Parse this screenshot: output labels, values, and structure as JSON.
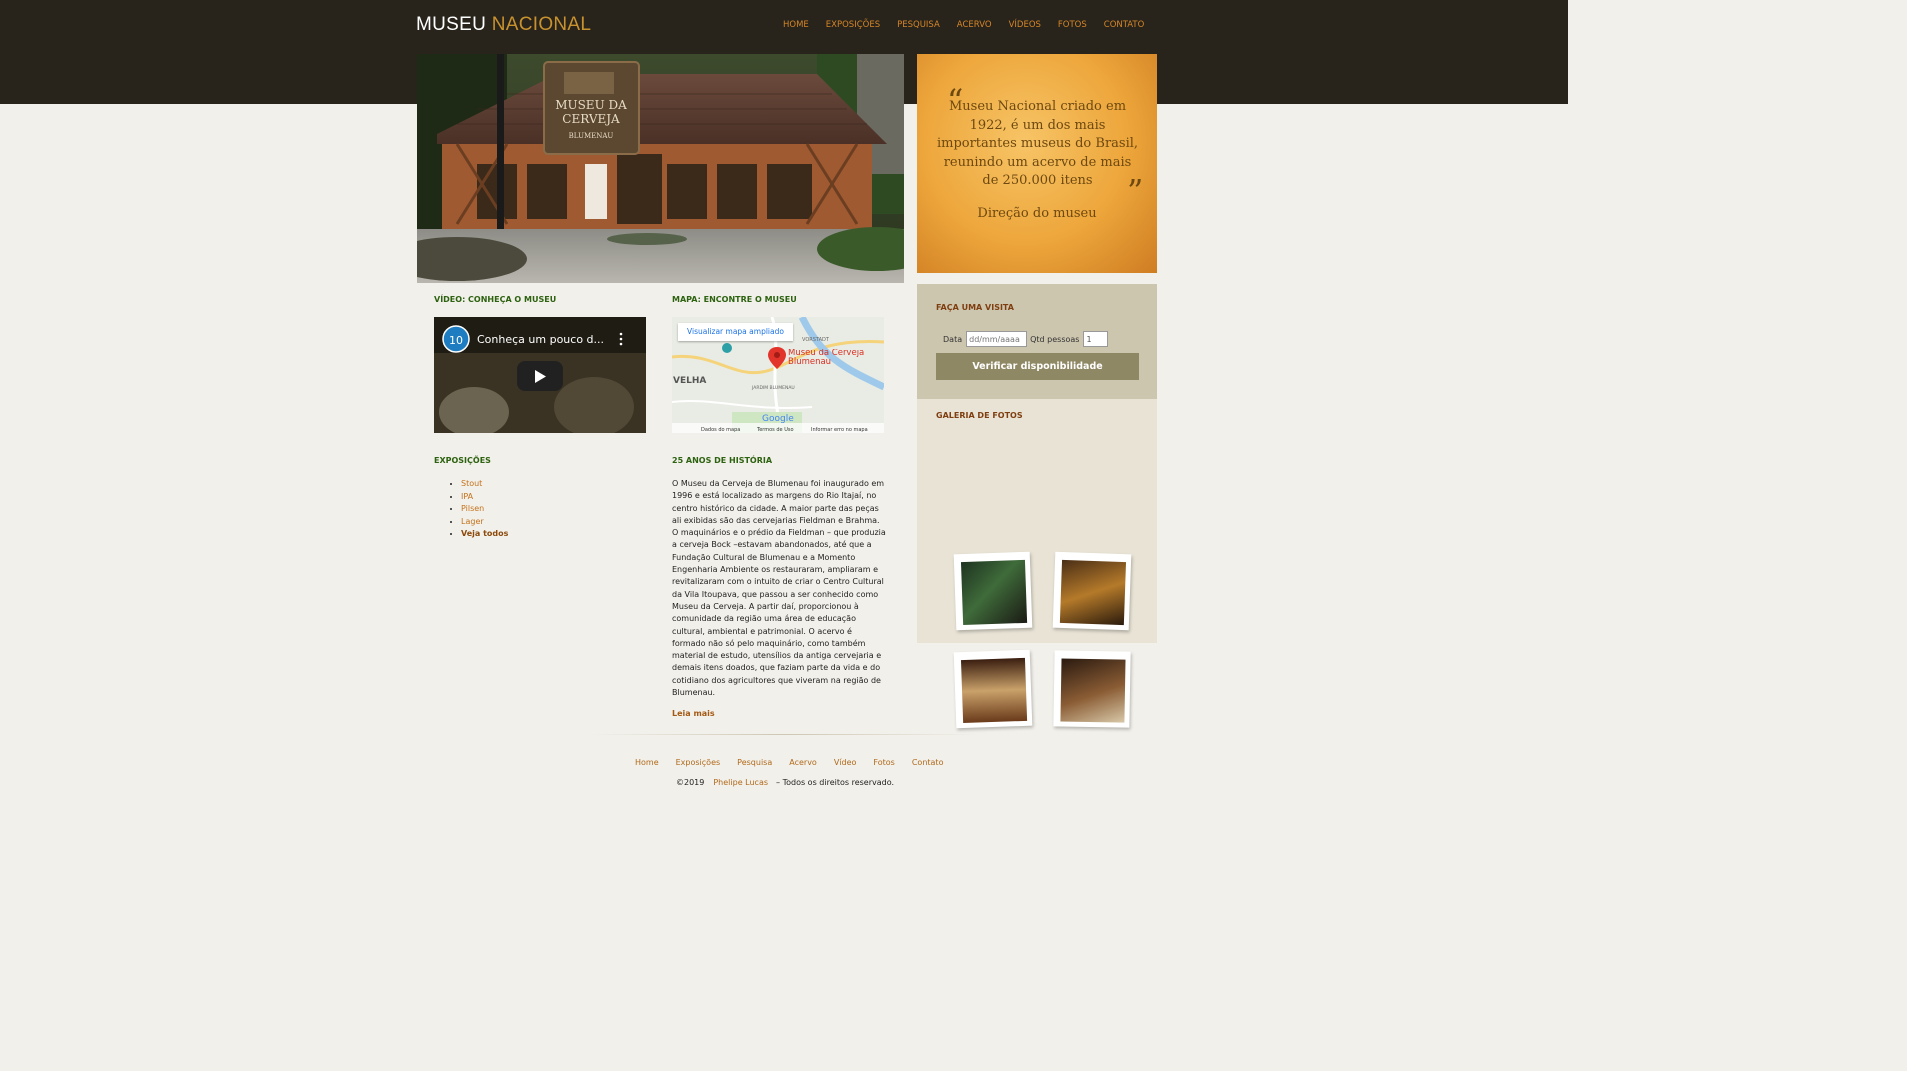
{
  "header": {
    "logo_part1": "MUSEU",
    "logo_part2": "NACIONAL",
    "nav": [
      "HOME",
      "EXPOSIÇÕES",
      "PESQUISA",
      "ACERVO",
      "VÍDEOS",
      "FOTOS",
      "CONTATO"
    ]
  },
  "hero": {
    "sign_line1": "MUSEU DA",
    "sign_line2": "CERVEJA",
    "sign_line3": "BLUMENAU"
  },
  "quote": {
    "open_mark": "“",
    "close_mark": "”",
    "text": "Museu Nacional criado em 1922, é um dos mais importantes museus do Brasil, reunindo um acervo de mais de 250.000 itens",
    "signature": "Direção do museu"
  },
  "video_section": {
    "title": "VÍDEO: CONHEÇA O MUSEU",
    "video_title": "Conheça um pouco d...",
    "channel_badge": "10"
  },
  "map_section": {
    "title": "MAPA: ENCONTRE O MUSEU",
    "enlarge_link": "Visualizar mapa ampliado",
    "place_name": "Museu da Cerveja Blumenau",
    "label_vorstadt": "VORSTADT",
    "label_velha": "VELHA",
    "label_jardim": "JARDIM BLUMENAU",
    "google": "Google",
    "footer_links": [
      "Dados do mapa",
      "Termos de Uso",
      "Informar erro no mapa"
    ]
  },
  "visit": {
    "title": "FAÇA UMA VISITA",
    "date_label": "Data",
    "date_placeholder": "dd/mm/aaaa",
    "qty_label": "Qtd pessoas",
    "qty_value": "1",
    "button": "Verificar disponibilidade"
  },
  "gallery": {
    "title": "GALERIA DE FOTOS"
  },
  "exposicoes": {
    "title": "EXPOSIÇÕES",
    "items": [
      "Stout",
      "IPA",
      "Pilsen",
      "Lager"
    ],
    "see_all": "Veja todos"
  },
  "history": {
    "title": "25 ANOS DE HISTÓRIA",
    "text": "O Museu da Cerveja de Blumenau foi inaugurado em 1996 e está localizado as margens do Rio Itajaí, no centro histórico da cidade. A maior parte das peças ali exibidas são das cervejarias Fieldman e Brahma. O maquinários e o prédio da Fieldman – que produzia a cerveja Bock –estavam abandonados, até que a Fundação Cultural de Blumenau e a Momento Engenharia Ambiente os restauraram, ampliaram e revitalizaram com o intuito de criar o Centro Cultural da Vila Itoupava, que passou a ser conhecido como Museu da Cerveja. A partir daí, proporcionou à comunidade da região uma área de educação cultural, ambiental e patrimonial. O acervo é formado não só pelo maquinário, como também material de estudo, utensílios da antiga cervejaria e demais itens doados, que faziam parte da vida e do cotidiano dos agricultores que viveram na região de Blumenau.",
    "read_more": "Leia mais"
  },
  "footer": {
    "nav": [
      "Home",
      "Exposições",
      "Pesquisa",
      "Acervo",
      "Vídeo",
      "Fotos",
      "Contato"
    ],
    "copyright": "©2019",
    "author": "Phelipe Lucas",
    "rights": "– Todos os direitos reservado."
  },
  "colors": {
    "header_bg": "#28241b",
    "accent_orange": "#d58528",
    "section_green": "#2c6210",
    "sidebar_brown": "#7f3e10",
    "button_bg": "#8f8865"
  }
}
